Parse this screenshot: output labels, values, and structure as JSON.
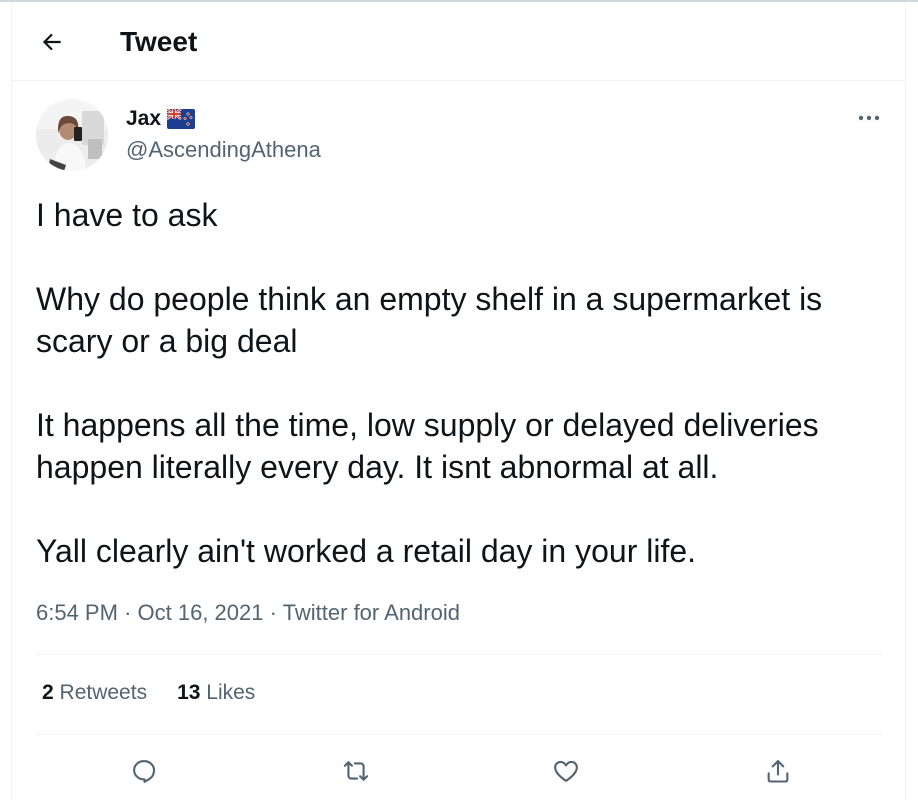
{
  "header": {
    "title": "Tweet",
    "back_icon": "arrow-left-icon"
  },
  "author": {
    "name": "Jax",
    "flag": "new-zealand-flag-icon",
    "handle": "@AscendingAthena"
  },
  "tweet": {
    "paragraphs": [
      "I have to ask",
      "Why do people think an empty shelf in a supermarket is scary or a big deal",
      "It happens all the time, low supply or delayed deliveries happen literally every day. It isnt abnormal at all.",
      "Yall clearly ain't worked a retail day in your life."
    ],
    "time": "6:54 PM",
    "date": "Oct 16, 2021",
    "source": "Twitter for Android",
    "separator": "·"
  },
  "stats": {
    "retweets_count": "2",
    "retweets_label": "Retweets",
    "likes_count": "13",
    "likes_label": "Likes"
  },
  "actions": [
    {
      "name": "reply",
      "icon": "reply-icon"
    },
    {
      "name": "retweet",
      "icon": "retweet-icon"
    },
    {
      "name": "like",
      "icon": "heart-icon"
    },
    {
      "name": "share",
      "icon": "share-icon"
    }
  ],
  "colors": {
    "text_primary": "#0f1419",
    "text_secondary": "#536471",
    "border": "#eff3f4"
  }
}
